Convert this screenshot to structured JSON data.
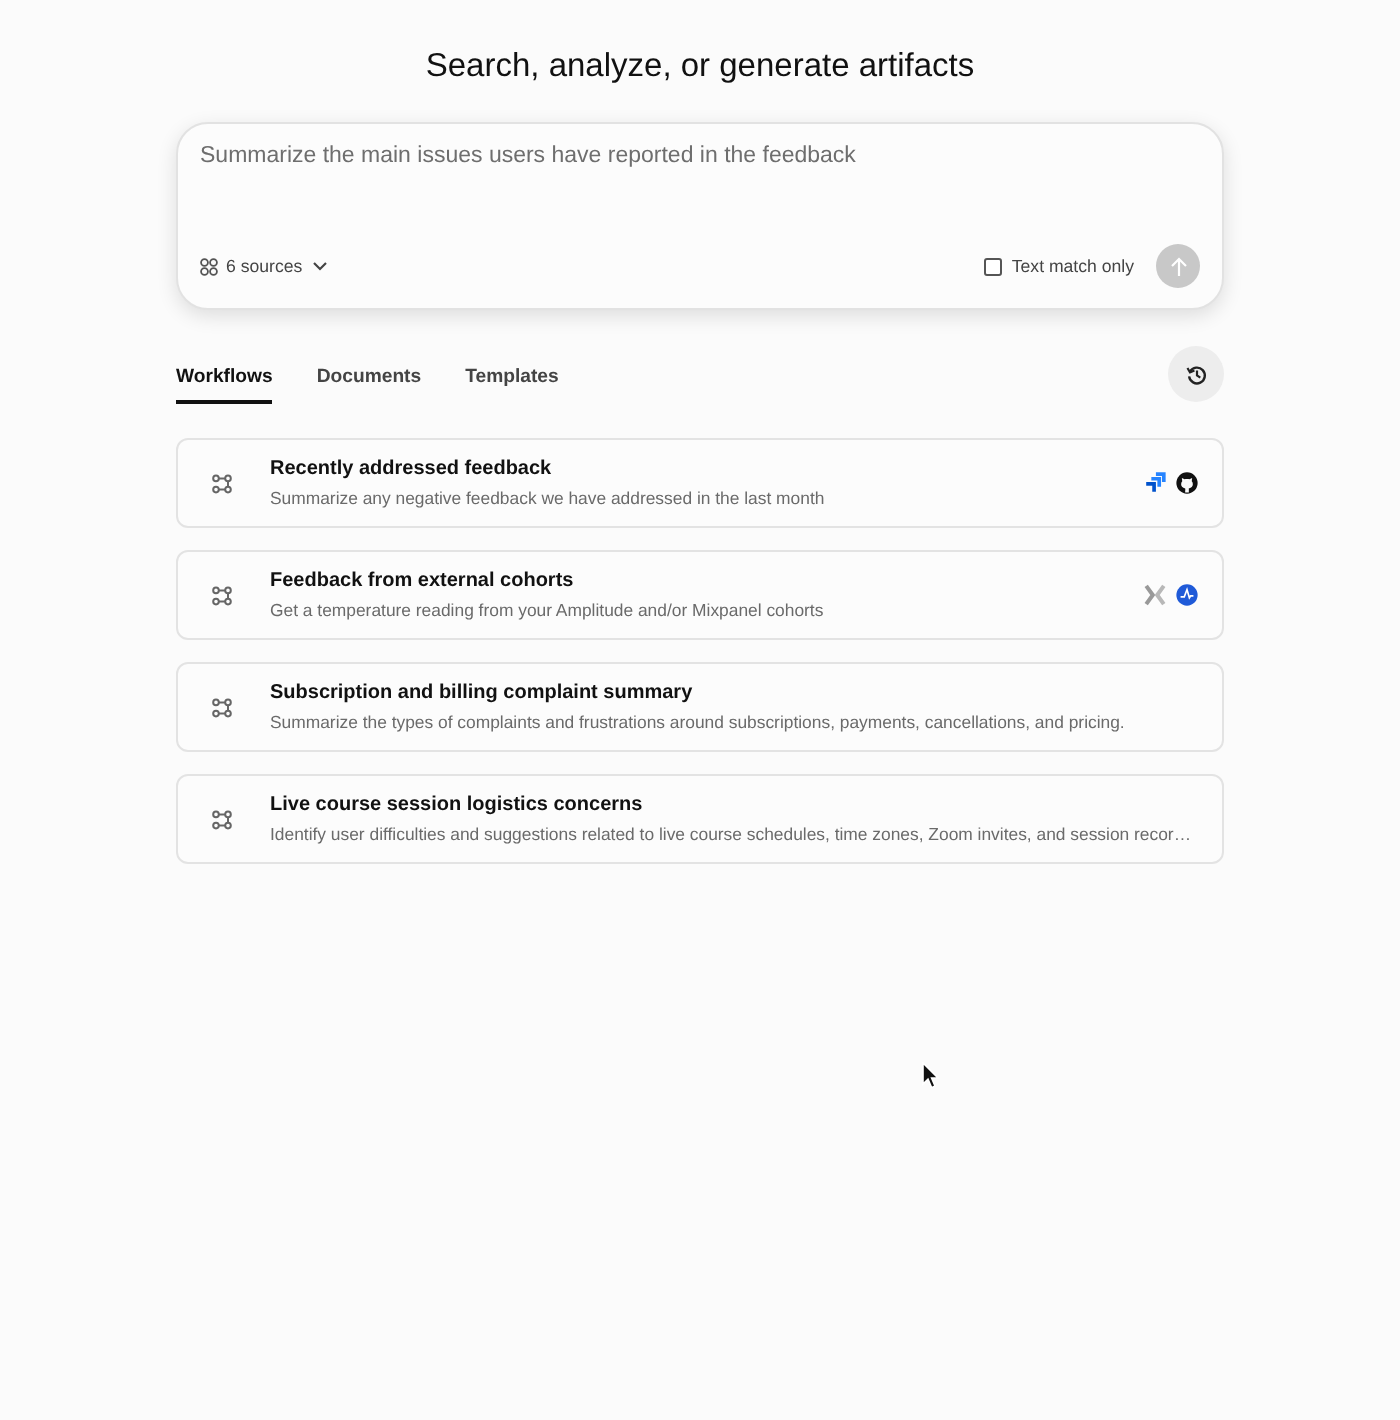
{
  "title": "Search, analyze, or generate artifacts",
  "prompt": {
    "placeholder": "Summarize the main issues users have reported in the feedback",
    "sources": "6 sources",
    "text_match": {
      "label": "Text match only",
      "checked": false
    },
    "send_disabled": true
  },
  "tabs": [
    {
      "label": "Workflows",
      "selected": true
    },
    {
      "label": "Documents",
      "selected": false
    },
    {
      "label": "Templates",
      "selected": false
    }
  ],
  "workflows": [
    {
      "title": "Recently addressed feedback",
      "description": "Summarize any negative feedback we have addressed in the last month",
      "integrations": [
        {
          "kind": "chevrons"
        },
        {
          "kind": "cat"
        }
      ]
    },
    {
      "title": "Feedback from external cohorts",
      "description": "Get a temperature reading from your Amplitude and/or Mixpanel cohorts",
      "integrations": [
        {
          "kind": "cross"
        },
        {
          "kind": "disc"
        }
      ]
    },
    {
      "title": "Subscription and billing complaint summary",
      "description": "Summarize the types of complaints and frustrations around subscriptions, payments, cancellations, and pricing."
    },
    {
      "title": "Live course session logistics concerns",
      "description": "Identify user difficulties and suggestions related to live course schedules, time zones, Zoom invites, and session recor…"
    }
  ]
}
